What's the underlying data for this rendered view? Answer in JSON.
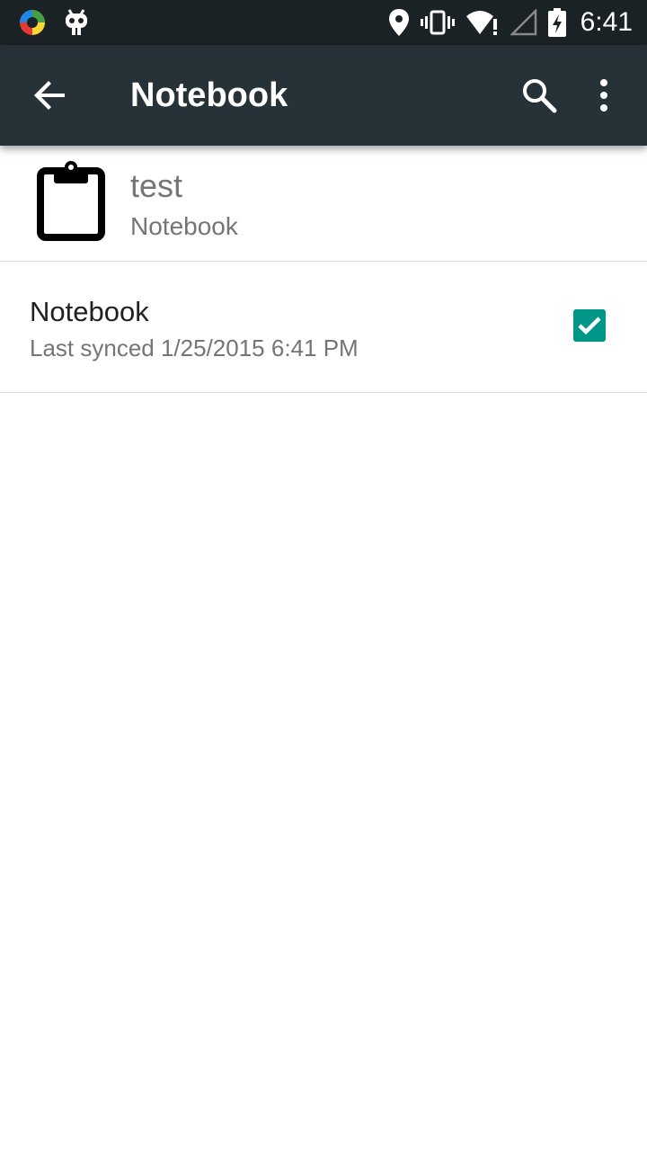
{
  "status_bar": {
    "time": "6:41",
    "icons": [
      "app-launcher-icon",
      "cyanogen-mascot-icon",
      "location-icon",
      "vibrate-icon",
      "wifi-icon",
      "signal-icon",
      "battery-charging-icon"
    ]
  },
  "toolbar": {
    "title": "Notebook",
    "actions": [
      "back-arrow-icon",
      "search-icon",
      "more-vert-icon"
    ]
  },
  "account": {
    "name": "test",
    "type": "Notebook"
  },
  "sync_items": [
    {
      "title": "Notebook",
      "last_synced": "Last synced 1/25/2015 6:41 PM",
      "checked": true
    }
  ],
  "colors": {
    "toolbar": "#263238",
    "status_bar": "#1b2226",
    "accent": "#009688"
  }
}
